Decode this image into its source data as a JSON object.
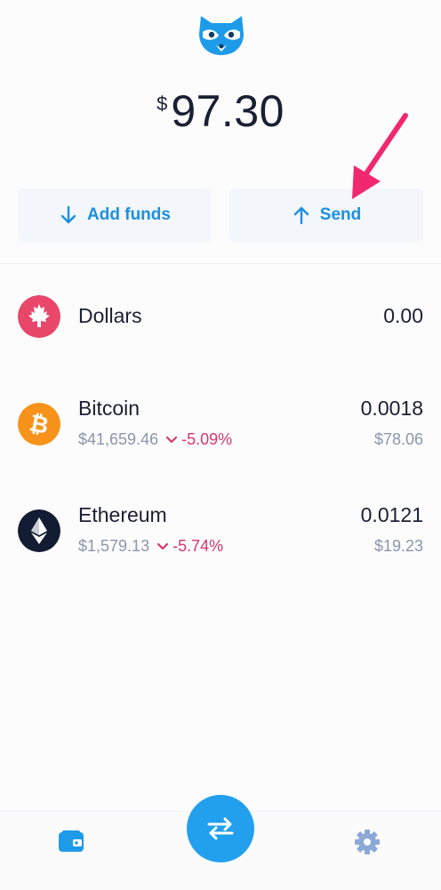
{
  "header": {
    "logo_icon": "raccoon-logo-icon"
  },
  "balance": {
    "currency_symbol": "$",
    "amount": "97.30"
  },
  "actions": {
    "add_funds_label": "Add funds",
    "send_label": "Send",
    "accent_color": "#1d8fe0"
  },
  "assets": [
    {
      "name": "Dollars",
      "amount": "0.00",
      "icon": "canada-flag-icon",
      "color": "#e8476a"
    },
    {
      "name": "Bitcoin",
      "price": "$41,659.46",
      "change": "-5.09%",
      "amount": "0.0018",
      "fiat": "$78.06",
      "icon": "bitcoin-icon",
      "color": "#f7931a"
    },
    {
      "name": "Ethereum",
      "price": "$1,579.13",
      "change": "-5.74%",
      "amount": "0.0121",
      "fiat": "$19.23",
      "icon": "ethereum-icon",
      "color": "#121c33"
    }
  ],
  "nav": {
    "wallet_icon": "wallet-icon",
    "swap_icon": "swap-icon",
    "settings_icon": "gear-icon"
  }
}
